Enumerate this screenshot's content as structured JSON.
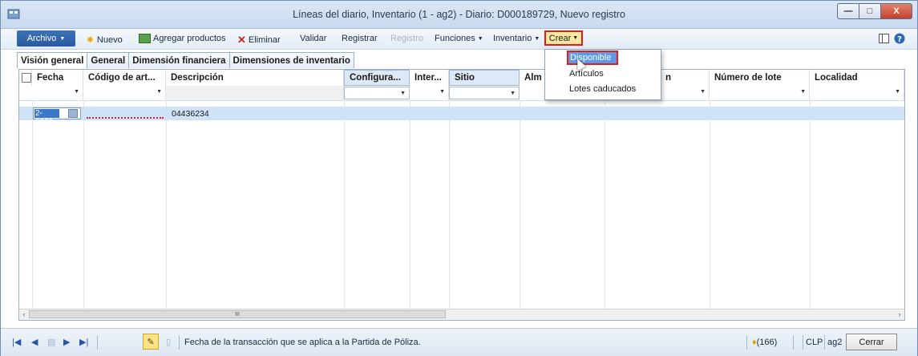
{
  "window": {
    "title": "Líneas del diario, Inventario (1 - ag2) - Diario: D000189729, Nuevo registro",
    "min_glyph": "—",
    "max_glyph": "□",
    "close_glyph": "X"
  },
  "toolbar": {
    "archivo": "Archivo",
    "nuevo": "Nuevo",
    "agregar": "Agregar productos",
    "eliminar": "Eliminar",
    "validar": "Validar",
    "registrar": "Registrar",
    "registro": "Registro",
    "funciones": "Funciones",
    "inventario": "Inventario",
    "crear": "Crear"
  },
  "tabs": [
    "Visión general",
    "General",
    "Dimensión financiera",
    "Dimensiones de inventario"
  ],
  "grid": {
    "columns": [
      "Fecha",
      "Código de art...",
      "Descripción",
      "Configura...",
      "Inter...",
      "Sitio",
      "Alm",
      "n",
      "Número de lote",
      "Localidad"
    ],
    "row": {
      "fecha": "2-2023",
      "descripcion": "04436234"
    },
    "scroll_thumb": "III"
  },
  "menu": {
    "items": [
      "Disponible",
      "Artículos",
      "Lotes caducados"
    ]
  },
  "status": {
    "message": "Fecha de la transacción que se aplica a la Partida de Póliza.",
    "count": "(166)",
    "currency": "CLP",
    "company": "ag2",
    "cerrar": "Cerrar"
  },
  "colors": {
    "accent": "#2a5ba0",
    "highlight_red": "#e21b1b",
    "row_selected": "#cfe2f6"
  }
}
